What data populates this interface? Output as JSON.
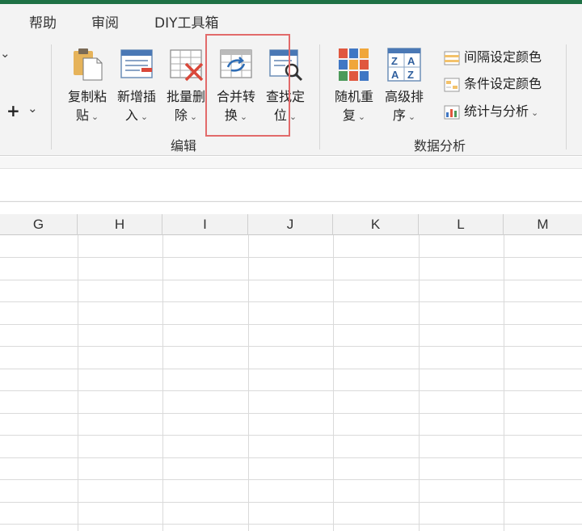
{
  "tabs": [
    "帮助",
    "审阅",
    "DIY工具箱"
  ],
  "left_fragments": {
    "chevron": "⌄",
    "plus": "+",
    "plus_chevron": "⌄"
  },
  "edit_group": {
    "label": "编辑",
    "buttons": [
      {
        "line1": "复制粘",
        "line2": "贴"
      },
      {
        "line1": "新增插",
        "line2": "入"
      },
      {
        "line1": "批量删",
        "line2": "除"
      },
      {
        "line1": "合并转",
        "line2": "换"
      },
      {
        "line1": "查找定",
        "line2": "位"
      }
    ]
  },
  "data_group": {
    "label": "数据分析",
    "buttons": [
      {
        "line1": "随机重",
        "line2": "复"
      },
      {
        "line1": "高级排",
        "line2": "序"
      }
    ],
    "small_buttons": [
      {
        "label": "间隔设定颜色",
        "has_dropdown": false
      },
      {
        "label": "条件设定颜色",
        "has_dropdown": false
      },
      {
        "label": "统计与分析",
        "has_dropdown": true
      }
    ]
  },
  "dropdown_glyph": "⌄",
  "columns": [
    "G",
    "H",
    "I",
    "J",
    "K",
    "L",
    "M"
  ],
  "colors": {
    "accent_green": "#1e7145",
    "highlight_red": "#e26a6a"
  }
}
